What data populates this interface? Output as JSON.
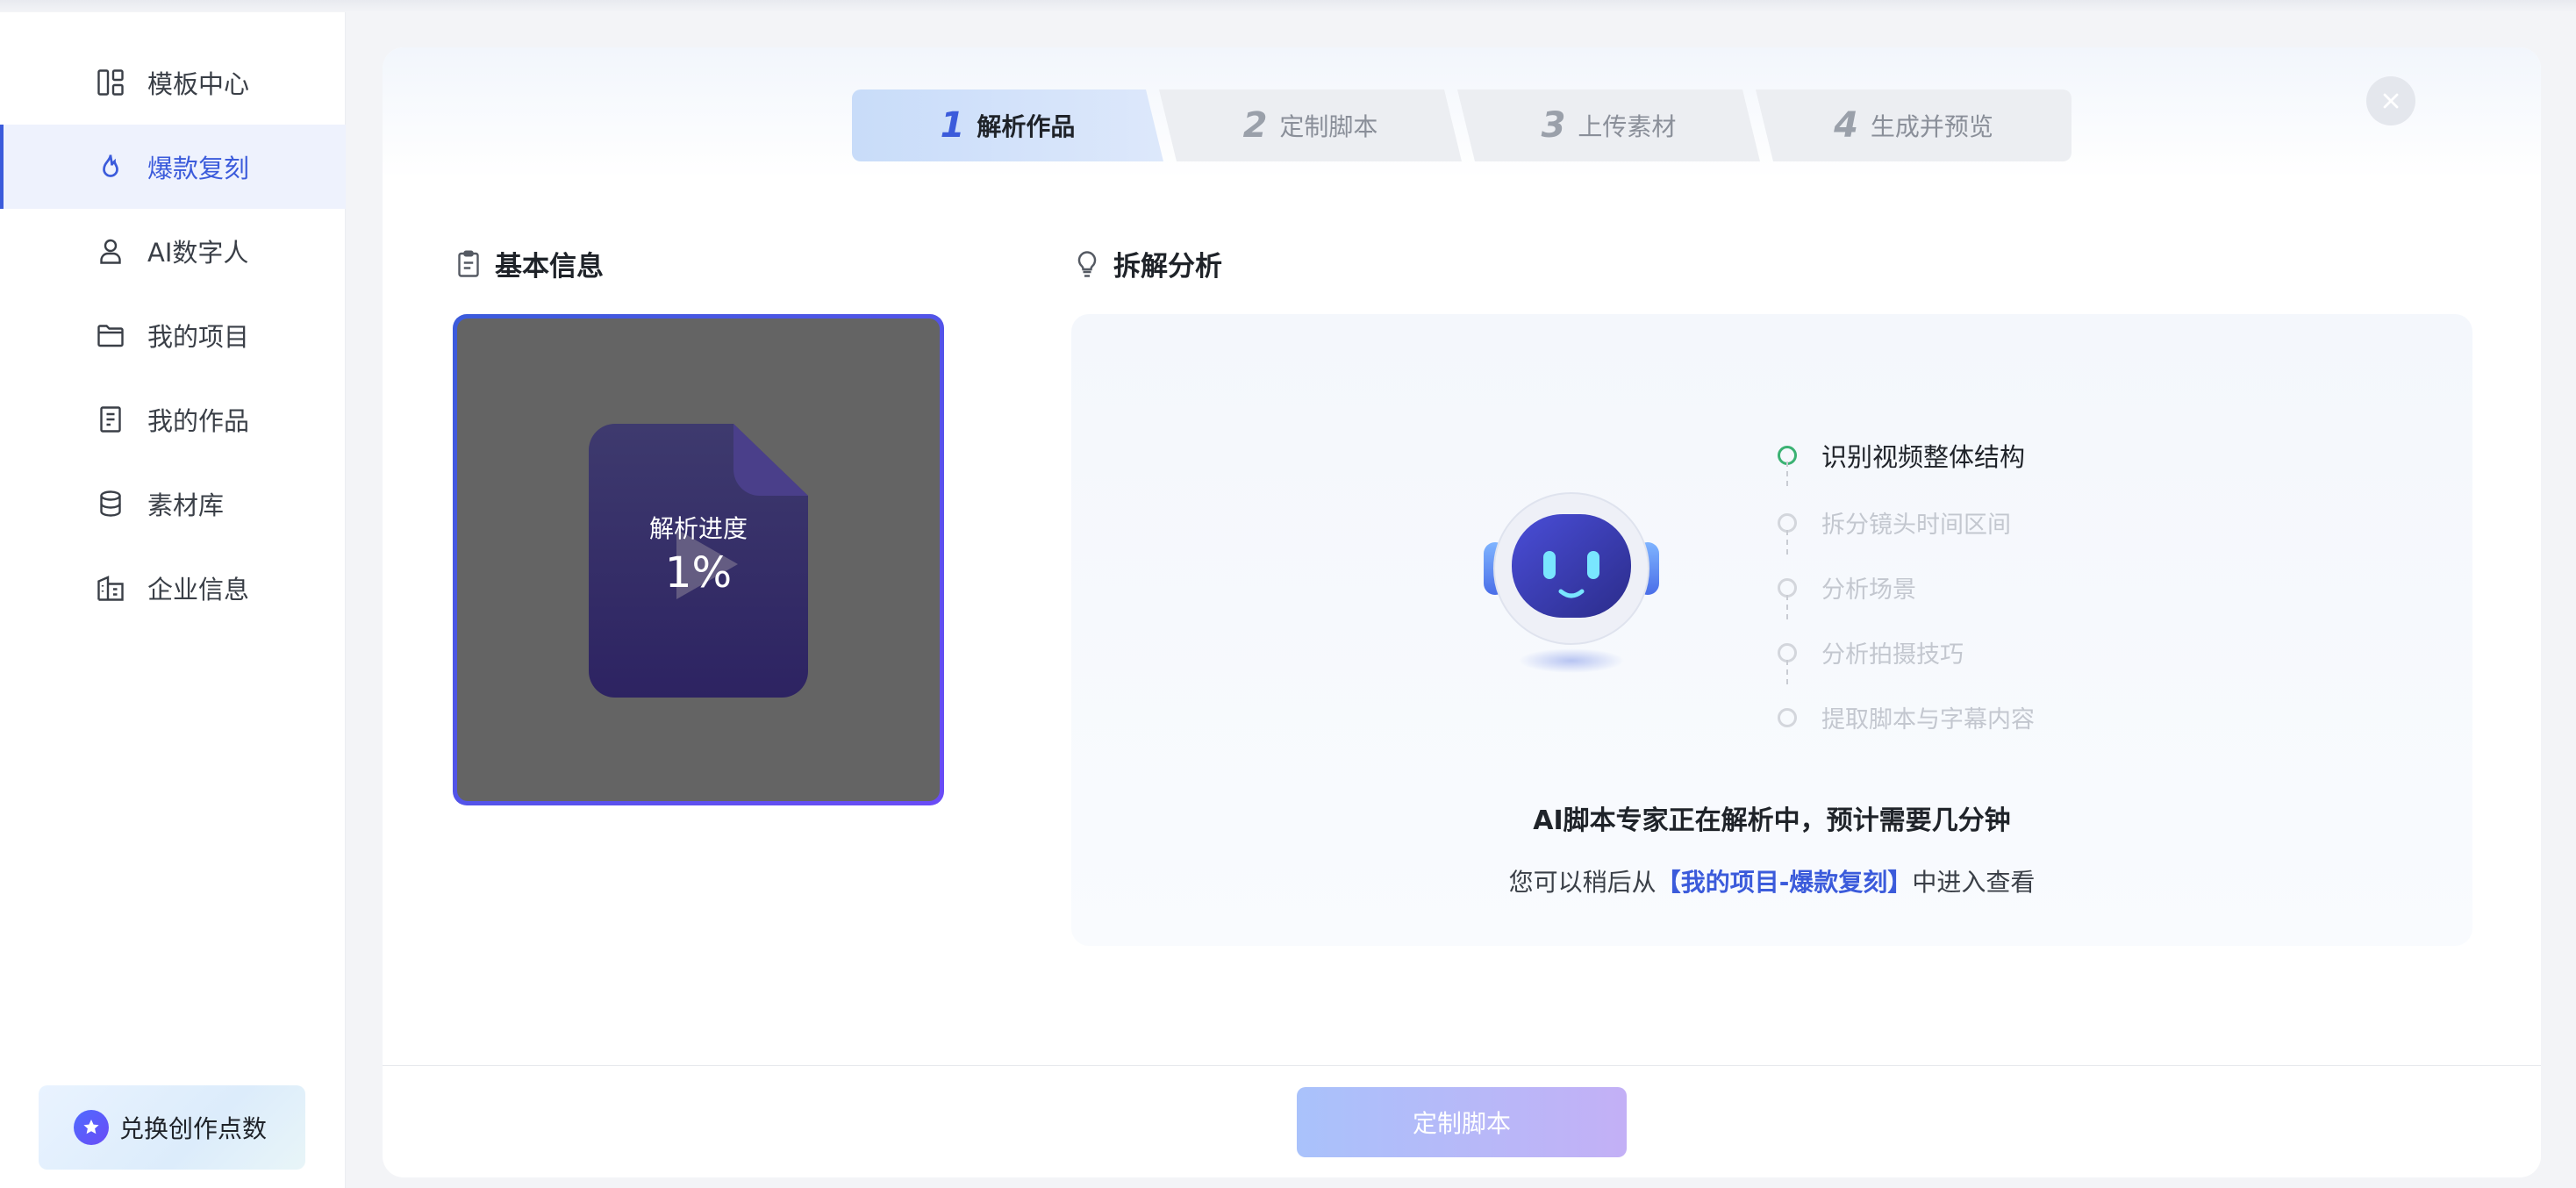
{
  "sidebar": {
    "items": [
      {
        "label": "模板中心",
        "icon": "template-icon",
        "active": false
      },
      {
        "label": "爆款复刻",
        "icon": "flame-icon",
        "active": true
      },
      {
        "label": "AI数字人",
        "icon": "person-icon",
        "active": false
      },
      {
        "label": "我的项目",
        "icon": "folder-icon",
        "active": false
      },
      {
        "label": "我的作品",
        "icon": "document-icon",
        "active": false
      },
      {
        "label": "素材库",
        "icon": "database-icon",
        "active": false
      },
      {
        "label": "企业信息",
        "icon": "building-icon",
        "active": false
      }
    ],
    "redeem_label": "兑换创作点数"
  },
  "steps": [
    {
      "num": "1",
      "label": "解析作品",
      "active": true
    },
    {
      "num": "2",
      "label": "定制脚本",
      "active": false
    },
    {
      "num": "3",
      "label": "上传素材",
      "active": false
    },
    {
      "num": "4",
      "label": "生成并预览",
      "active": false
    }
  ],
  "basic_info": {
    "title": "基本信息",
    "progress_label": "解析进度",
    "progress_value": "1%",
    "progress_fraction": 0.01
  },
  "analysis": {
    "title": "拆解分析",
    "timeline": [
      {
        "label": "识别视频整体结构",
        "active": true
      },
      {
        "label": "拆分镜头时间区间",
        "active": false
      },
      {
        "label": "分析场景",
        "active": false
      },
      {
        "label": "分析拍摄技巧",
        "active": false
      },
      {
        "label": "提取脚本与字幕内容",
        "active": false
      }
    ],
    "status_main": "AI脚本专家正在解析中，预计需要几分钟",
    "status_sub_prefix": "您可以稍后从",
    "status_sub_link": "【我的项目-爆款复刻】",
    "status_sub_suffix": "中进入查看"
  },
  "footer": {
    "primary_button": "定制脚本"
  },
  "colors": {
    "accent": "#3b5bdb",
    "active_dot": "#3bb273",
    "step_active_bg": "#c8dcf9"
  }
}
